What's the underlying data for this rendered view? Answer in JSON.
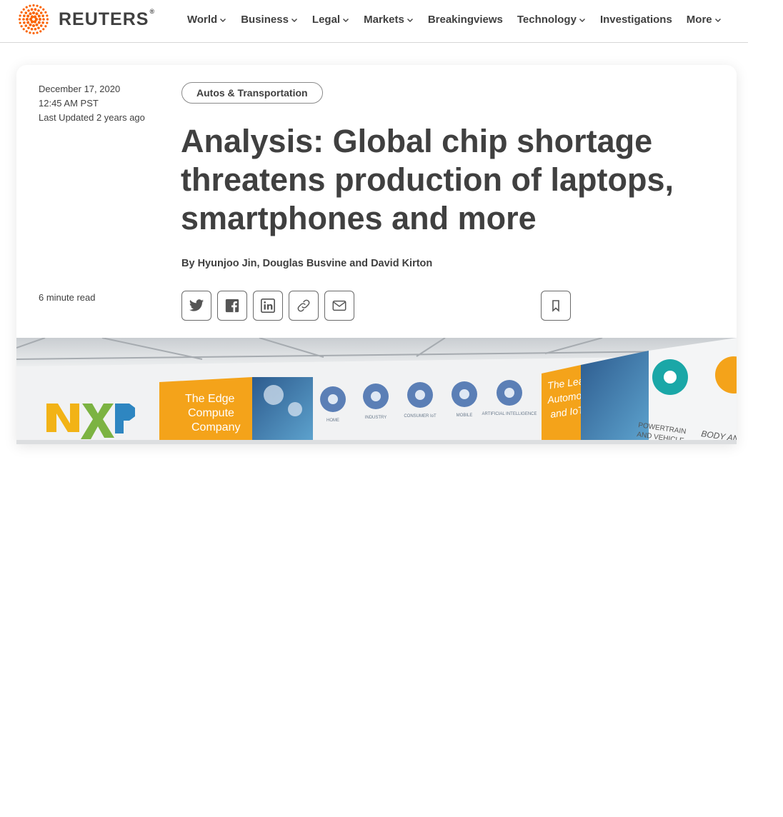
{
  "brand": {
    "name": "REUTERS",
    "reg_mark": "®",
    "accent": "#fa6400"
  },
  "nav": {
    "items": [
      {
        "label": "World",
        "has_dropdown": true
      },
      {
        "label": "Business",
        "has_dropdown": true
      },
      {
        "label": "Legal",
        "has_dropdown": true
      },
      {
        "label": "Markets",
        "has_dropdown": true
      },
      {
        "label": "Breakingviews",
        "has_dropdown": false
      },
      {
        "label": "Technology",
        "has_dropdown": true
      },
      {
        "label": "Investigations",
        "has_dropdown": false
      },
      {
        "label": "More",
        "has_dropdown": true
      }
    ]
  },
  "article": {
    "date": "December 17, 2020",
    "time": "12:45 AM PST",
    "updated": "Last Updated 2 years ago",
    "read_time": "6 minute read",
    "category": "Autos & Transportation",
    "headline": "Analysis: Global chip shortage threatens production of laptops, smartphones and more",
    "byline": "By Hyunjoo Jin, Douglas Busvine and David Kirton"
  },
  "share_icons": [
    "twitter-icon",
    "facebook-icon",
    "linkedin-icon",
    "link-icon",
    "email-icon"
  ],
  "hero": {
    "logo_text": "NXP",
    "banner_yellow": "The Edge Compute Company",
    "banner_leader": "The Leader in Automotive and IoT",
    "icon_labels": [
      "HOME",
      "INDUSTRY",
      "CONSUMER IoT",
      "MOBILE",
      "ARTIFICIAL INTELLIGENCE"
    ],
    "panel_powertrain": "POWERTRAIN AND VEHICLE DYNAMICS",
    "panel_body": "BODY AN"
  }
}
